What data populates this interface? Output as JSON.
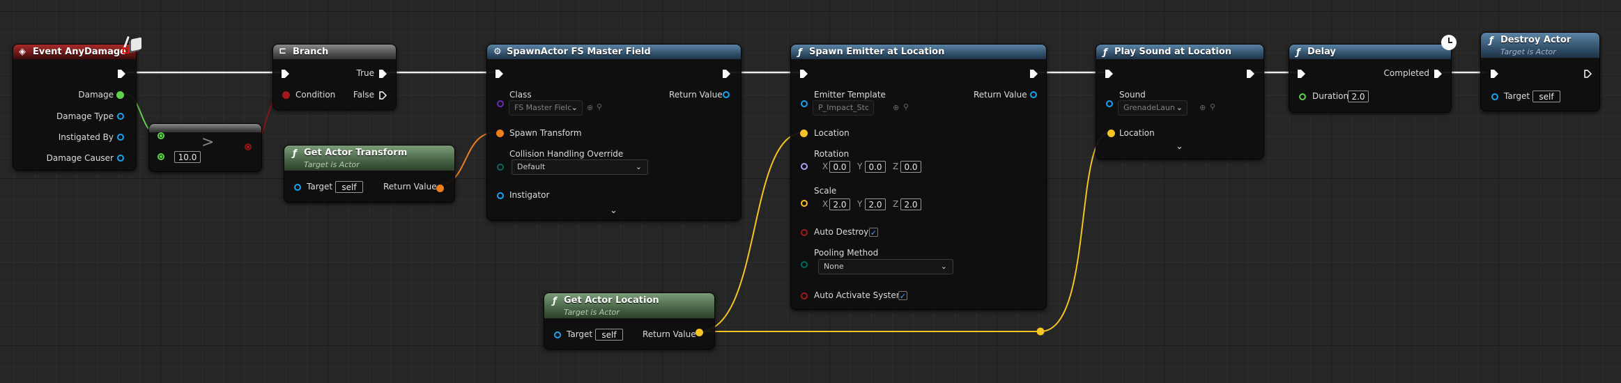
{
  "nodes": {
    "event_anydamage": {
      "title": "Event AnyDamage",
      "pins": {
        "damage": "Damage",
        "damage_type": "Damage Type",
        "instigated_by": "Instigated By",
        "damage_causer": "Damage Causer"
      }
    },
    "compare": {
      "symbol": ">",
      "value": "10.0"
    },
    "branch": {
      "title": "Branch",
      "true_label": "True",
      "false_label": "False",
      "condition": "Condition"
    },
    "get_actor_transform": {
      "title": "Get Actor Transform",
      "subtitle": "Target is Actor",
      "target": "Target",
      "target_value": "self",
      "return_value": "Return Value"
    },
    "spawn_actor": {
      "title": "SpawnActor FS Master Field",
      "class": "Class",
      "class_value": "FS Master Fielc",
      "return_value": "Return Value",
      "spawn_transform": "Spawn Transform",
      "collision": "Collision Handling Override",
      "collision_value": "Default",
      "instigator": "Instigator"
    },
    "spawn_emitter": {
      "title": "Spawn Emitter at Location",
      "emitter_template": "Emitter Template",
      "emitter_value": "P_Impact_Stone",
      "return_value": "Return Value",
      "location": "Location",
      "rotation": "Rotation",
      "rot_x": "0.0",
      "rot_y": "0.0",
      "rot_z": "0.0",
      "scale": "Scale",
      "scale_x": "2.0",
      "scale_y": "2.0",
      "scale_z": "2.0",
      "auto_destroy": "Auto Destroy",
      "pooling": "Pooling Method",
      "pooling_value": "None",
      "auto_activate": "Auto Activate System",
      "x": "X",
      "y": "Y",
      "z": "Z"
    },
    "play_sound": {
      "title": "Play Sound at Location",
      "sound": "Sound",
      "sound_value": "GrenadeLaunch",
      "location": "Location"
    },
    "delay": {
      "title": "Delay",
      "completed": "Completed",
      "duration": "Duration",
      "duration_value": "2.0"
    },
    "destroy_actor": {
      "title": "Destroy Actor",
      "subtitle": "Target is Actor",
      "target": "Target",
      "target_value": "self"
    },
    "get_actor_location": {
      "title": "Get Actor Location",
      "subtitle": "Target is Actor",
      "target": "Target",
      "target_value": "self",
      "return_value": "Return Value"
    }
  },
  "icons": {
    "function": "ƒ",
    "checkmark": "✓",
    "chevron_down": "⌄"
  },
  "colors": {
    "exec": "#ffffff",
    "float": "#5ed34a",
    "struct_transform": "#f07d1e",
    "vector": "#f7c325",
    "rotator": "#a7a6f5",
    "object": "#1ba4f0",
    "class": "#6a2bb8",
    "bool": "#a31919",
    "byte": "#006a5c",
    "event_header": "#a82a2a",
    "function_header": "#4a7394",
    "pure_header": "#6e8e6a"
  }
}
